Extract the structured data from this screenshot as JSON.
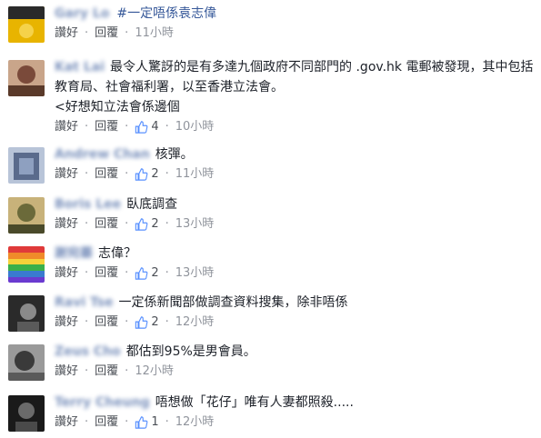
{
  "comments": [
    {
      "author": "Gary Lo",
      "tag": "#一定唔係袁志偉",
      "text": "",
      "likes": "",
      "time": "11小時",
      "avatar_colors": [
        "#e8b400",
        "#2a2a2a"
      ]
    },
    {
      "author": "Kat Lai",
      "tag": "",
      "text": "最令人驚訝的是有多達九個政府不同部門的 .gov.hk 電郵被發現，其中包括教育局、社會福利署，以至香港立法會。",
      "more": "<好想知立法會係邊個",
      "likes": "4",
      "time": "10小時",
      "avatar_colors": [
        "#7a4a3a",
        "#c9a58a"
      ]
    },
    {
      "author": "Andrew Chan",
      "tag": "",
      "text": "核彈。",
      "likes": "2",
      "time": "11小時",
      "avatar_colors": [
        "#5a6b8c",
        "#b8c4d8"
      ]
    },
    {
      "author": "Boris Lee",
      "tag": "",
      "text": "臥底調查",
      "likes": "2",
      "time": "13小時",
      "avatar_colors": [
        "#6b6a3a",
        "#c8b27a"
      ]
    },
    {
      "author": "謝宛蓁",
      "tag": "",
      "text": "志偉？",
      "likes": "2",
      "time": "13小時",
      "avatar_colors": [
        "#e03a3a",
        "#6a3ad0"
      ]
    },
    {
      "author": "Ravi Tse",
      "tag": "",
      "text": "一定係新聞部做調查資料搜集，除非唔係",
      "likes": "2",
      "time": "12小時",
      "avatar_colors": [
        "#2a2a2a",
        "#8a8a8a"
      ]
    },
    {
      "author": "Zeus Cho",
      "tag": "",
      "text": "都估到95%是男會員。",
      "likes": "",
      "time": "12小時",
      "avatar_colors": [
        "#3a3a3a",
        "#9a9a9a"
      ]
    },
    {
      "author": "Terry Cheung",
      "tag": "",
      "text": "唔想做「花仔」唯有人妻都照殺.....",
      "likes": "1",
      "time": "12小時",
      "avatar_colors": [
        "#1a1a1a",
        "#6a6a6a"
      ]
    }
  ],
  "labels": {
    "like": "讚好",
    "reply": "回覆",
    "dot": "·"
  },
  "colors": {
    "link": "#365899",
    "meta": "#90949c",
    "like_icon": "#5890ff"
  }
}
